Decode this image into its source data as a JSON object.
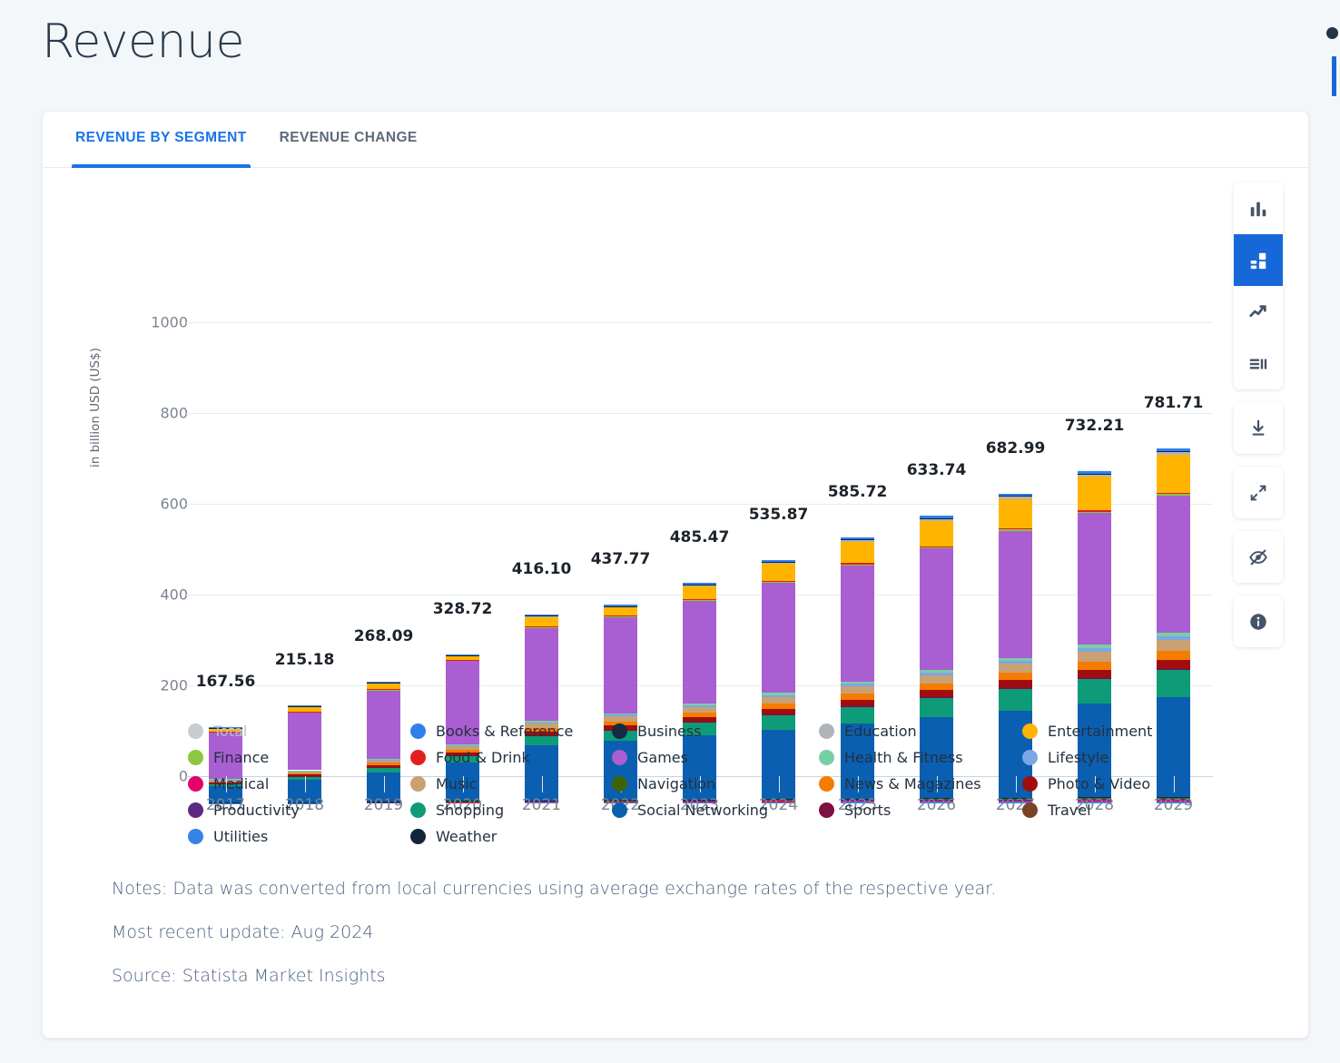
{
  "page": {
    "title": "Revenue"
  },
  "tabs": [
    {
      "label": "REVENUE BY SEGMENT",
      "active": true
    },
    {
      "label": "REVENUE CHANGE",
      "active": false
    }
  ],
  "toolbar": {
    "groups": [
      {
        "buttons": [
          {
            "name": "column-chart-icon",
            "label": "Column chart",
            "active": false
          },
          {
            "name": "stacked-bar-chart-icon",
            "label": "Stacked bar chart",
            "active": true
          },
          {
            "name": "line-chart-icon",
            "label": "Line chart",
            "active": false
          },
          {
            "name": "table-view-icon",
            "label": "Table view",
            "active": false
          }
        ]
      },
      {
        "buttons": [
          {
            "name": "download-icon",
            "label": "Download",
            "active": false
          }
        ]
      },
      {
        "buttons": [
          {
            "name": "expand-icon",
            "label": "Expand",
            "active": false
          }
        ]
      },
      {
        "buttons": [
          {
            "name": "hide-eye-icon",
            "label": "Hide details",
            "active": false
          }
        ]
      },
      {
        "buttons": [
          {
            "name": "info-icon",
            "label": "Information",
            "active": false
          }
        ]
      }
    ]
  },
  "notes": [
    "Notes: Data was converted from local currencies using average exchange rates of the respective year.",
    "Most recent update: Aug 2024",
    "Source: Statista Market Insights"
  ],
  "legend": {
    "columns": [
      [
        {
          "label": "Total",
          "color": "#c9ccd1",
          "muted": true
        },
        {
          "label": "Finance",
          "color": "#8dc63f",
          "muted": false
        },
        {
          "label": "Medical",
          "color": "#e5006d",
          "muted": false
        },
        {
          "label": "Productivity",
          "color": "#5c2a7e",
          "muted": false
        },
        {
          "label": "Utilities",
          "color": "#3583e8",
          "muted": false
        }
      ],
      [
        {
          "label": "Books & Reference",
          "color": "#2f80ed",
          "muted": false
        },
        {
          "label": "Food & Drink",
          "color": "#e02020",
          "muted": false
        },
        {
          "label": "Music",
          "color": "#c9a173",
          "muted": false
        },
        {
          "label": "Shopping",
          "color": "#0e9b78",
          "muted": false
        },
        {
          "label": "Weather",
          "color": "#14253b",
          "muted": false
        }
      ],
      [
        {
          "label": "Business",
          "color": "#152b43",
          "muted": false
        },
        {
          "label": "Games",
          "color": "#a95ed2",
          "muted": false
        },
        {
          "label": "Navigation",
          "color": "#3d6306",
          "muted": false
        },
        {
          "label": "Social Networking",
          "color": "#0a5fb0",
          "muted": false
        }
      ],
      [
        {
          "label": "Education",
          "color": "#b0b4b8",
          "muted": false
        },
        {
          "label": "Health & Fitness",
          "color": "#79cfa4",
          "muted": false
        },
        {
          "label": "News & Magazines",
          "color": "#f57c00",
          "muted": false
        },
        {
          "label": "Sports",
          "color": "#7d0f42",
          "muted": false
        }
      ],
      [
        {
          "label": "Entertainment",
          "color": "#ffb400",
          "muted": false
        },
        {
          "label": "Lifestyle",
          "color": "#7ba7e3",
          "muted": false
        },
        {
          "label": "Photo & Video",
          "color": "#a10d0d",
          "muted": false
        },
        {
          "label": "Travel",
          "color": "#7a4326",
          "muted": false
        }
      ]
    ]
  },
  "chart_data": {
    "type": "bar",
    "stacked": true,
    "title": "Revenue",
    "xlabel": "",
    "ylabel": "in billion USD (US$)",
    "ylim": [
      0,
      1000
    ],
    "yticks": [
      0,
      200,
      400,
      600,
      800,
      1000
    ],
    "grid": true,
    "legend_position": "bottom",
    "categories": [
      "2017",
      "2018",
      "2019",
      "2020",
      "2021",
      "2022",
      "2023",
      "2024",
      "2025",
      "2026",
      "2027",
      "2028",
      "2029"
    ],
    "totals": [
      167.56,
      215.18,
      268.09,
      328.72,
      416.1,
      437.77,
      485.47,
      535.87,
      585.72,
      633.74,
      682.99,
      732.21,
      781.71
    ],
    "total_labels": [
      "167.56",
      "215.18",
      "268.09",
      "328.72",
      "416.10",
      "437.77",
      "485.47",
      "535.87",
      "585.72",
      "633.74",
      "682.99",
      "732.21",
      "781.71"
    ],
    "stack_order_bottom_to_top": [
      "Utilities",
      "Medical",
      "Productivity",
      "Navigation",
      "Business",
      "Social Networking",
      "Shopping",
      "Sports",
      "Photo & Video",
      "News & Magazines",
      "Music",
      "Lifestyle",
      "Health & Fitness",
      "Games",
      "Finance",
      "Food & Drink",
      "Entertainment",
      "Education",
      "Weather",
      "Books & Reference"
    ],
    "series": [
      {
        "name": "Utilities",
        "color": "#3583e8",
        "values": [
          0.8,
          1.0,
          1.3,
          1.7,
          2.2,
          2.4,
          2.7,
          3.0,
          3.3,
          3.6,
          3.9,
          4.2,
          4.5
        ]
      },
      {
        "name": "Medical",
        "color": "#e5006d",
        "values": [
          0.5,
          0.7,
          0.9,
          1.2,
          1.6,
          1.8,
          2.0,
          2.2,
          2.5,
          2.7,
          3.0,
          3.2,
          3.5
        ]
      },
      {
        "name": "Productivity",
        "color": "#5c2a7e",
        "values": [
          0.4,
          0.6,
          0.8,
          1.1,
          1.4,
          1.6,
          1.8,
          2.0,
          2.2,
          2.4,
          2.6,
          2.9,
          3.1
        ]
      },
      {
        "name": "Navigation",
        "color": "#3d6306",
        "values": [
          0.2,
          0.3,
          0.4,
          0.5,
          0.7,
          0.8,
          0.9,
          1.0,
          1.1,
          1.2,
          1.3,
          1.4,
          1.5
        ]
      },
      {
        "name": "Business",
        "color": "#152b43",
        "values": [
          0.3,
          0.4,
          0.5,
          0.7,
          0.9,
          1.0,
          1.1,
          1.3,
          1.4,
          1.5,
          1.7,
          1.8,
          1.9
        ]
      },
      {
        "name": "Social Networking",
        "color": "#0a5fb0",
        "values": [
          36.0,
          48.0,
          64.0,
          85.0,
          122.0,
          130.0,
          141.0,
          152.0,
          162.0,
          175.0,
          188.0,
          202.0,
          214.0
        ]
      },
      {
        "name": "Shopping",
        "color": "#0e9b78",
        "values": [
          5.5,
          8.0,
          11.0,
          15.0,
          20.0,
          23.0,
          27.0,
          31.0,
          36.0,
          41.0,
          47.0,
          53.0,
          59.0
        ]
      },
      {
        "name": "Sports",
        "color": "#7d0f42",
        "values": [
          0.6,
          0.8,
          1.1,
          1.4,
          1.8,
          2.0,
          2.3,
          2.6,
          2.9,
          3.2,
          3.5,
          3.8,
          4.1
        ]
      },
      {
        "name": "Photo & Video",
        "color": "#a10d0d",
        "values": [
          2.0,
          3.0,
          4.2,
          5.5,
          7.5,
          8.5,
          9.8,
          11.0,
          12.5,
          14.0,
          15.5,
          17.0,
          18.5
        ]
      },
      {
        "name": "News & Magazines",
        "color": "#f57c00",
        "values": [
          2.2,
          3.2,
          4.5,
          6.0,
          8.0,
          9.2,
          10.5,
          12.0,
          13.5,
          15.0,
          16.5,
          18.0,
          19.5
        ]
      },
      {
        "name": "Music",
        "color": "#c9a173",
        "values": [
          2.8,
          4.0,
          5.5,
          7.2,
          9.5,
          10.8,
          12.2,
          13.8,
          15.5,
          17.2,
          19.0,
          21.0,
          23.0
        ]
      },
      {
        "name": "Lifestyle",
        "color": "#7ba7e3",
        "values": [
          1.0,
          1.4,
          1.9,
          2.5,
          3.3,
          3.8,
          4.3,
          4.8,
          5.4,
          6.0,
          6.6,
          7.2,
          7.8
        ]
      },
      {
        "name": "Health & Fitness",
        "color": "#79cfa4",
        "values": [
          0.9,
          1.3,
          1.8,
          2.4,
          3.2,
          3.7,
          4.2,
          4.8,
          5.4,
          6.0,
          6.6,
          7.3,
          8.0
        ]
      },
      {
        "name": "Games",
        "color": "#a95ed2",
        "values": [
          104.0,
          128.0,
          150.0,
          185.0,
          206.0,
          212.0,
          225.0,
          240.0,
          252.0,
          263.0,
          275.0,
          286.0,
          296.0
        ]
      },
      {
        "name": "Finance",
        "color": "#8dc63f",
        "values": [
          0.3,
          0.4,
          0.6,
          0.8,
          1.0,
          1.2,
          1.3,
          1.5,
          1.7,
          1.8,
          2.0,
          2.2,
          2.4
        ]
      },
      {
        "name": "Food & Drink",
        "color": "#e02020",
        "values": [
          0.4,
          0.6,
          0.8,
          1.0,
          1.4,
          1.6,
          1.8,
          2.0,
          2.2,
          2.5,
          2.7,
          3.0,
          3.2
        ]
      },
      {
        "name": "Entertainment",
        "color": "#ffb400",
        "values": [
          7.0,
          10.0,
          13.5,
          8.0,
          20.0,
          17.0,
          28.0,
          38.0,
          46.0,
          55.0,
          64.0,
          72.0,
          81.0
        ]
      },
      {
        "name": "Education",
        "color": "#b0b4b8",
        "values": [
          0.7,
          1.0,
          1.4,
          1.8,
          2.4,
          2.8,
          3.2,
          3.6,
          4.1,
          4.6,
          5.1,
          5.6,
          6.1
        ]
      },
      {
        "name": "Weather",
        "color": "#14253b",
        "values": [
          0.2,
          0.3,
          0.4,
          0.5,
          0.7,
          0.8,
          0.9,
          1.0,
          1.1,
          1.2,
          1.4,
          1.5,
          1.6
        ]
      },
      {
        "name": "Books & Reference",
        "color": "#2f80ed",
        "values": [
          0.8,
          1.2,
          1.5,
          2.0,
          2.6,
          3.0,
          3.4,
          3.8,
          4.3,
          4.8,
          5.3,
          5.8,
          6.3
        ]
      }
    ]
  }
}
